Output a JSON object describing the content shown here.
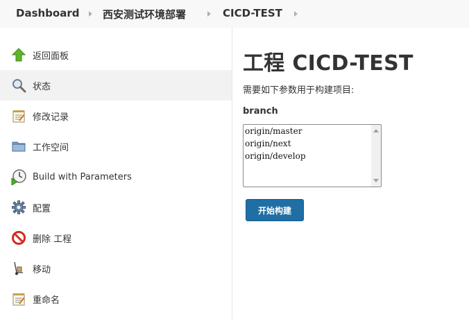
{
  "breadcrumb": {
    "items": [
      {
        "label": "Dashboard"
      },
      {
        "label": "西安测试环境部署"
      },
      {
        "label": "CICD-TEST"
      }
    ]
  },
  "sidebar": {
    "items": [
      {
        "label": "返回面板",
        "icon": "up-arrow-icon"
      },
      {
        "label": "状态",
        "icon": "magnifier-icon"
      },
      {
        "label": "修改记录",
        "icon": "notepad-icon"
      },
      {
        "label": "工作空间",
        "icon": "folder-icon"
      },
      {
        "label": "Build with Parameters",
        "icon": "clock-play-icon"
      },
      {
        "label": "配置",
        "icon": "gear-icon"
      },
      {
        "label": "删除 工程",
        "icon": "no-entry-icon"
      },
      {
        "label": "移动",
        "icon": "hand-truck-icon"
      },
      {
        "label": "重命名",
        "icon": "notepad-icon"
      }
    ],
    "active_index": 1
  },
  "main": {
    "title": "工程 CICD-TEST",
    "description": "需要如下参数用于构建项目:",
    "parameter": {
      "name": "branch",
      "options": [
        "origin/master",
        "origin/next",
        "origin/develop"
      ]
    },
    "build_button": "开始构建"
  },
  "colors": {
    "accent": "#1f6fa5",
    "active_row": "#f2f2f2",
    "topbar": "#f8f8f8"
  }
}
